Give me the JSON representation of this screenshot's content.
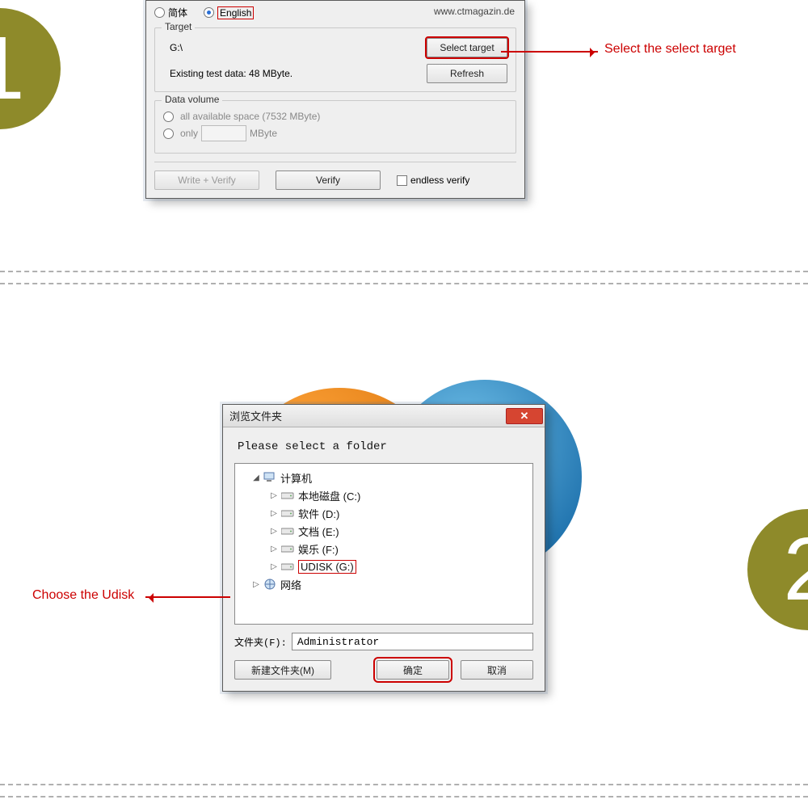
{
  "badges": {
    "one": "1",
    "two": "2"
  },
  "anno": {
    "select_target": "Select the select target",
    "choose_udisk": "Choose the Udisk"
  },
  "app1": {
    "lang": {
      "simplified": "简体",
      "english": "English"
    },
    "url": "www.ctmagazin.de",
    "target": {
      "legend": "Target",
      "path": "G:\\",
      "existing": "Existing test data: 48 MByte.",
      "select_btn": "Select target",
      "refresh_btn": "Refresh"
    },
    "volume": {
      "legend": "Data volume",
      "all": "all available space (7532 MByte)",
      "only": "only",
      "unit": "MByte"
    },
    "bottom": {
      "write_verify": "Write + Verify",
      "verify": "Verify",
      "endless": "endless verify"
    }
  },
  "app2": {
    "title": "浏览文件夹",
    "instruction": "Please select a folder",
    "tree": {
      "computer": "计算机",
      "c": "本地磁盘 (C:)",
      "d": "软件 (D:)",
      "e": "文档 (E:)",
      "f": "娱乐 (F:)",
      "g": "UDISK (G:)",
      "network": "网络"
    },
    "folder_label": "文件夹(F):",
    "folder_value": "Administrator",
    "buttons": {
      "new_folder": "新建文件夹(M)",
      "ok": "确定",
      "cancel": "取消"
    }
  }
}
